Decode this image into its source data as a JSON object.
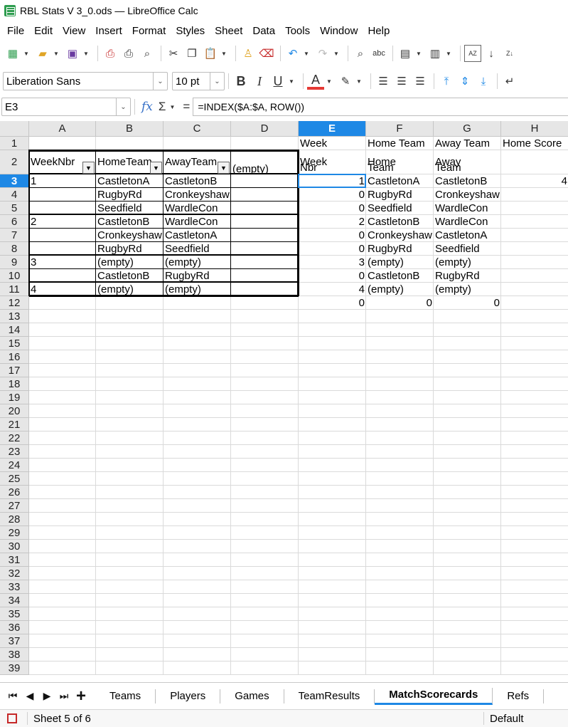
{
  "window": {
    "title": "RBL Stats V 3_0.ods — LibreOffice Calc"
  },
  "menu": [
    "File",
    "Edit",
    "View",
    "Insert",
    "Format",
    "Styles",
    "Sheet",
    "Data",
    "Tools",
    "Window",
    "Help"
  ],
  "toolbar": {
    "font_name": "Liberation Sans",
    "font_size": "10 pt",
    "bold_label": "B",
    "italic_label": "I",
    "underline_label": "U",
    "font_color_label": "A",
    "sort_ascending_label": "AZ",
    "spellcheck_label": "abc"
  },
  "formula_bar": {
    "name_box": "E3",
    "fx_label": "fx",
    "sum_label": "Σ",
    "equals_label": "=",
    "formula": "=INDEX($A:$A, ROW())"
  },
  "columns": [
    "A",
    "B",
    "C",
    "D",
    "E",
    "F",
    "G",
    "H"
  ],
  "selected_column": "E",
  "rows": [
    "1",
    "2",
    "3",
    "4",
    "5",
    "6",
    "7",
    "8",
    "9",
    "10",
    "11",
    "12",
    "13",
    "14",
    "15",
    "16",
    "17",
    "18",
    "19",
    "20",
    "21",
    "22",
    "23",
    "24",
    "25",
    "26",
    "27",
    "28",
    "29",
    "30",
    "31",
    "32",
    "33",
    "34",
    "35",
    "36",
    "37",
    "38",
    "39"
  ],
  "selected_row": "3",
  "cells": {
    "E1": "Week",
    "F1": "Home Team",
    "G1": "Away Team",
    "H1": "Home Score",
    "A2": "WeekNbr",
    "B2": "HomeTeam",
    "C2": "AwayTeam",
    "D2": "(empty)",
    "E2a": "Week",
    "E2b": "Nbr",
    "F2a": "Home",
    "F2b": "Team",
    "G2a": "Away",
    "G2b": "Team",
    "A3": "1",
    "B3": "CastletonA",
    "C3": "CastletonB",
    "E3": "1",
    "F3": "CastletonA",
    "G3": "CastletonB",
    "H3": "4",
    "B4": "RugbyRd",
    "C4": "Cronkeyshaw",
    "E4": "0",
    "F4": "RugbyRd",
    "G4": "Cronkeyshaw",
    "B5": "Seedfield",
    "C5": "WardleCon",
    "E5": "0",
    "F5": "Seedfield",
    "G5": "WardleCon",
    "A6": "2",
    "B6": "CastletonB",
    "C6": "WardleCon",
    "E6": "2",
    "F6": "CastletonB",
    "G6": "WardleCon",
    "B7": "Cronkeyshaw",
    "C7": "CastletonA",
    "E7": "0",
    "F7": "Cronkeyshaw",
    "G7": "CastletonA",
    "B8": "RugbyRd",
    "C8": "Seedfield",
    "E8": "0",
    "F8": "RugbyRd",
    "G8": "Seedfield",
    "A9": "3",
    "B9": "(empty)",
    "C9": "(empty)",
    "E9": "3",
    "F9": "(empty)",
    "G9": "(empty)",
    "B10": "CastletonB",
    "C10": "RugbyRd",
    "E10": "0",
    "F10": "CastletonB",
    "G10": "RugbyRd",
    "A11": "4",
    "B11": "(empty)",
    "C11": "(empty)",
    "E11": "4",
    "F11": "(empty)",
    "G11": "(empty)",
    "E12": "0",
    "F12": "0",
    "G12": "0"
  },
  "sheet_tabs": [
    "Teams",
    "Players",
    "Games",
    "TeamResults",
    "MatchScorecards",
    "Refs"
  ],
  "active_tab": "MatchScorecards",
  "status": {
    "sheet_position": "Sheet 5 of 6",
    "page_style": "Default"
  },
  "colors": {
    "accent": "#1e88e5",
    "header_bg": "#e6e6e6",
    "font_color_bar": "#e53935"
  }
}
